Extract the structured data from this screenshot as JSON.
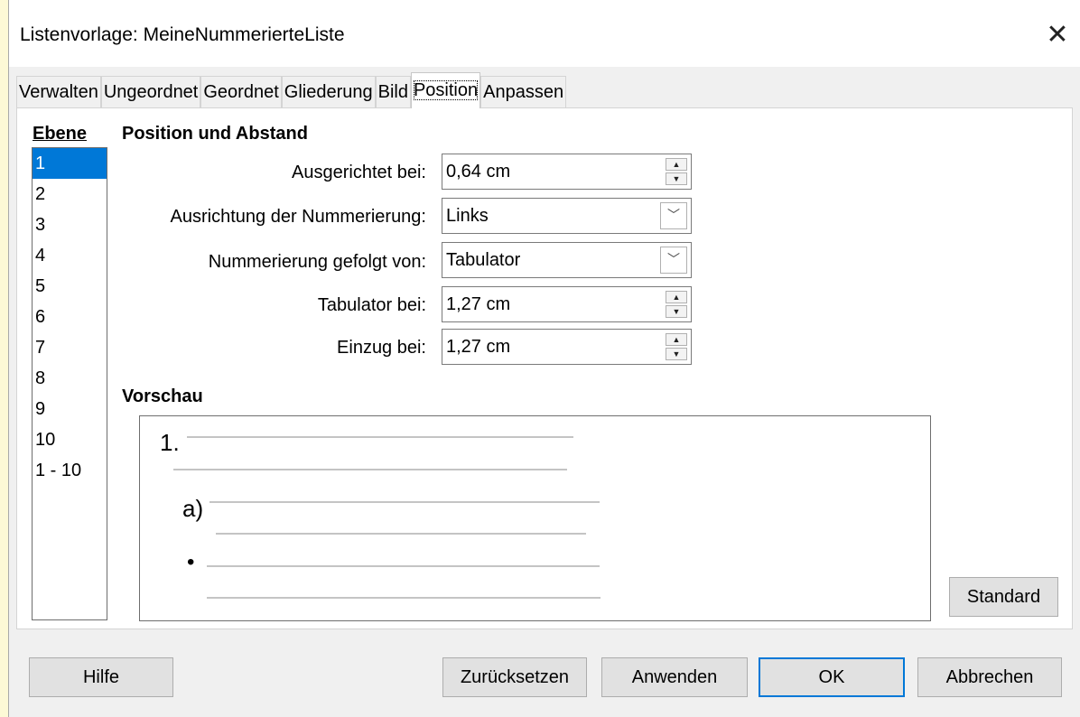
{
  "window": {
    "title": "Listenvorlage: MeineNummerierteListe",
    "close_glyph": "✕"
  },
  "tabs": [
    {
      "label": "Verwalten"
    },
    {
      "label": "Ungeordnet"
    },
    {
      "label": "Geordnet"
    },
    {
      "label": "Gliederung"
    },
    {
      "label": "Bild"
    },
    {
      "label": "Position",
      "active": true
    },
    {
      "label": "Anpassen"
    }
  ],
  "level": {
    "label": "Ebene",
    "items": [
      "1",
      "2",
      "3",
      "4",
      "5",
      "6",
      "7",
      "8",
      "9",
      "10",
      "1 - 10"
    ],
    "selected": "1"
  },
  "position": {
    "heading": "Position und Abstand",
    "aligned_at": {
      "label": "Ausgerichtet bei:",
      "value": "0,64 cm"
    },
    "numbering_alignment": {
      "label": "Ausrichtung der Nummerierung:",
      "value": "Links"
    },
    "numbering_followed_by": {
      "label": "Nummerierung gefolgt von:",
      "value": "Tabulator"
    },
    "tab_stop_at": {
      "label": "Tabulator bei:",
      "value": "1,27 cm"
    },
    "indent_at": {
      "label": "Einzug bei:",
      "value": "1,27 cm"
    }
  },
  "preview": {
    "heading": "Vorschau",
    "level1_marker": "1.",
    "level2_marker": "a)",
    "level3_marker": "•"
  },
  "buttons": {
    "standard": "Standard",
    "help": "Hilfe",
    "reset": "Zurücksetzen",
    "apply": "Anwenden",
    "ok": "OK",
    "cancel": "Abbrechen"
  },
  "colors": {
    "selection": "#0078d7",
    "default_button_border": "#0078d7"
  }
}
